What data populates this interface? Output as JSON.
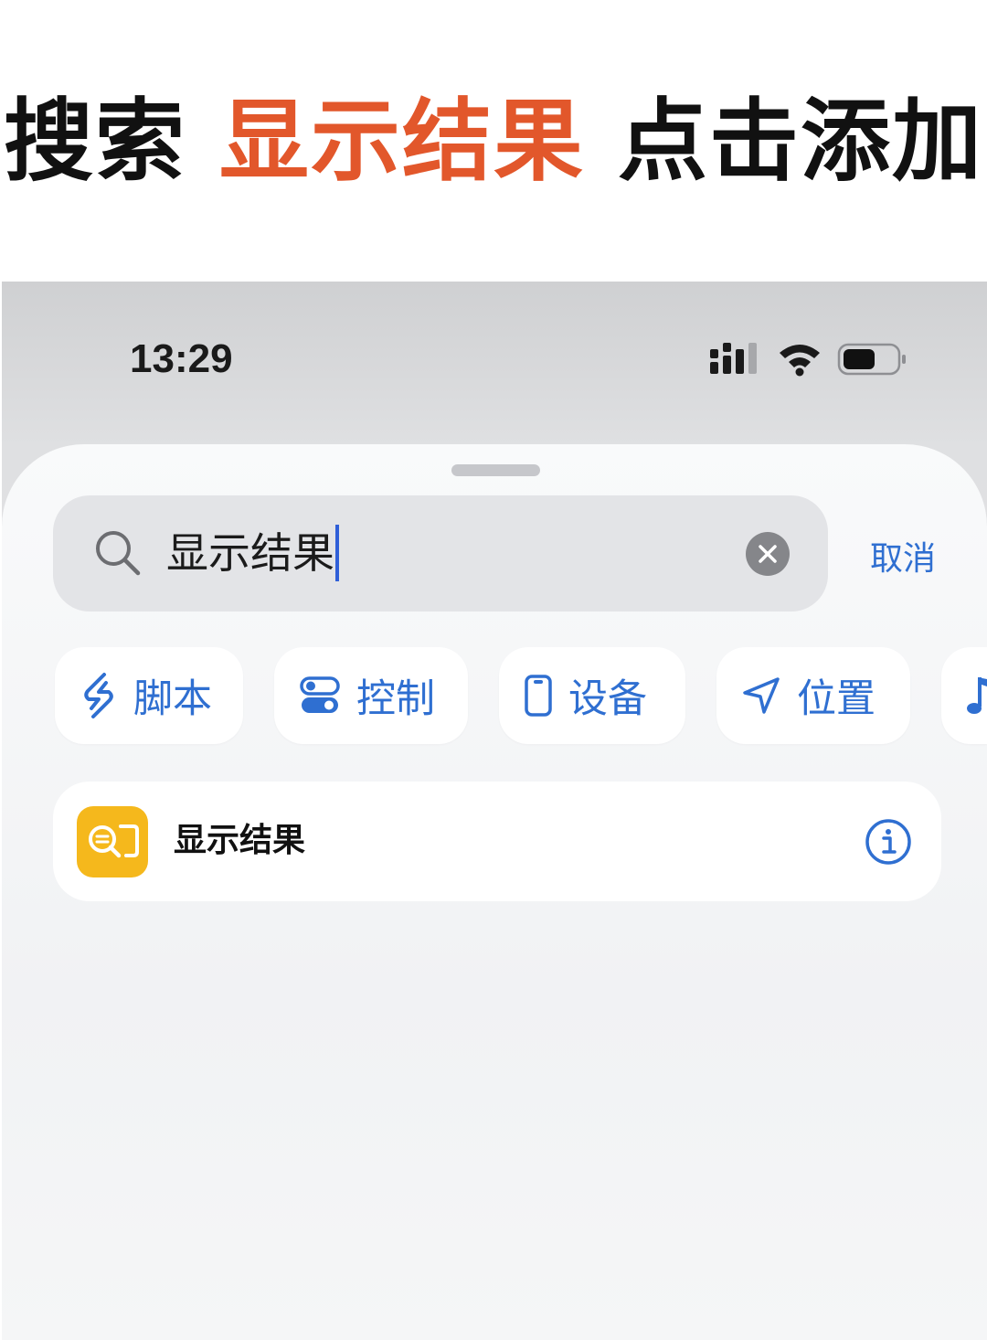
{
  "headline": {
    "part1": "搜索",
    "part2": "显示结果",
    "part3": "点击添加"
  },
  "colors": {
    "accent_orange": "#e2572b",
    "system_blue": "#2f6fd1",
    "app_icon_yellow": "#f5b81c"
  },
  "status_bar": {
    "time": "13:29",
    "icons": [
      "signal-icon",
      "wifi-icon",
      "battery-icon"
    ]
  },
  "search": {
    "value": "显示结果",
    "cancel_label": "取消"
  },
  "chips": [
    {
      "label": "脚本",
      "icon": "script-icon"
    },
    {
      "label": "控制",
      "icon": "toggle-icon"
    },
    {
      "label": "设备",
      "icon": "phone-icon"
    },
    {
      "label": "位置",
      "icon": "location-arrow-icon"
    },
    {
      "label": "",
      "icon": "music-note-icon"
    }
  ],
  "results": [
    {
      "label": "显示结果",
      "icon": "show-result-icon"
    }
  ]
}
